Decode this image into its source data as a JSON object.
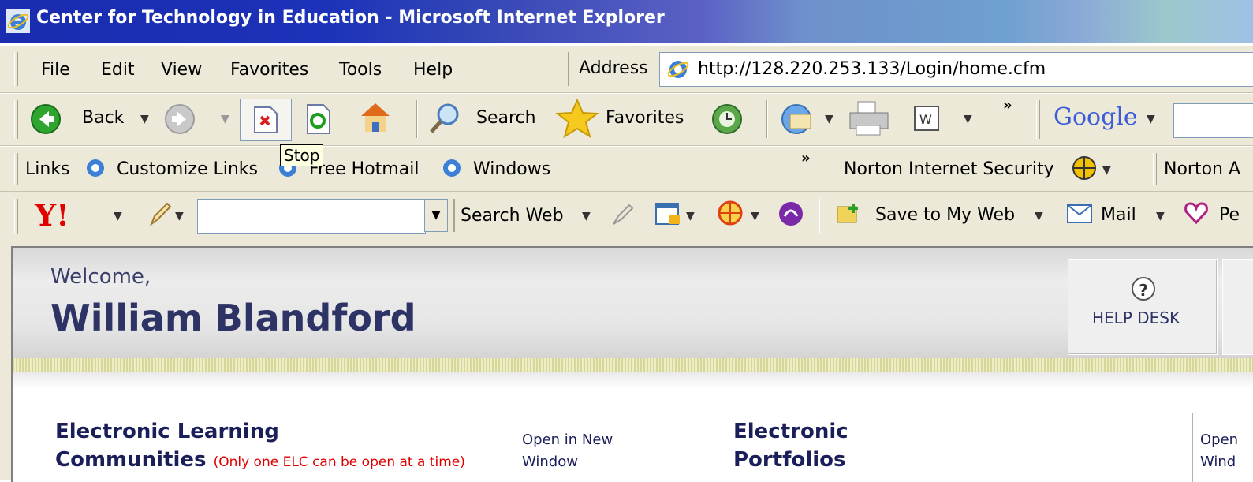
{
  "window": {
    "title": "Center for Technology in Education - Microsoft Internet Explorer"
  },
  "menu": {
    "items": [
      "File",
      "Edit",
      "View",
      "Favorites",
      "Tools",
      "Help"
    ]
  },
  "address": {
    "label": "Address",
    "url": "http://128.220.253.133/Login/home.cfm"
  },
  "toolbar": {
    "back_label": "Back",
    "search_label": "Search",
    "favorites_label": "Favorites",
    "more": "»",
    "google_label": "Google",
    "tooltip": "Stop"
  },
  "links": {
    "label": "Links",
    "items": [
      "Customize Links",
      "Free Hotmail",
      "Windows"
    ],
    "more": "»",
    "norton_security": "Norton Internet Security",
    "norton_a": "Norton A"
  },
  "yahoo": {
    "logo": "Y!",
    "search_input_value": "",
    "search_web_label": "Search Web",
    "save_label": "Save to My Web",
    "mail_label": "Mail",
    "pe_label": "Pe"
  },
  "page": {
    "welcome": "Welcome,",
    "user_name": "William Blandford",
    "help_desk": "HELP DESK",
    "help_icon_glyph": "?",
    "elc_title_line1": "Electronic Learning",
    "elc_title_line2": "Communities",
    "elc_note": "(Only one ELC can be open at a time)",
    "open_new_line1": "Open in New",
    "open_new_line2": "Window",
    "ep_title_line1": "Electronic",
    "ep_title_line2": "Portfolios",
    "open2_line1": "Open",
    "open2_line2": "Wind"
  }
}
